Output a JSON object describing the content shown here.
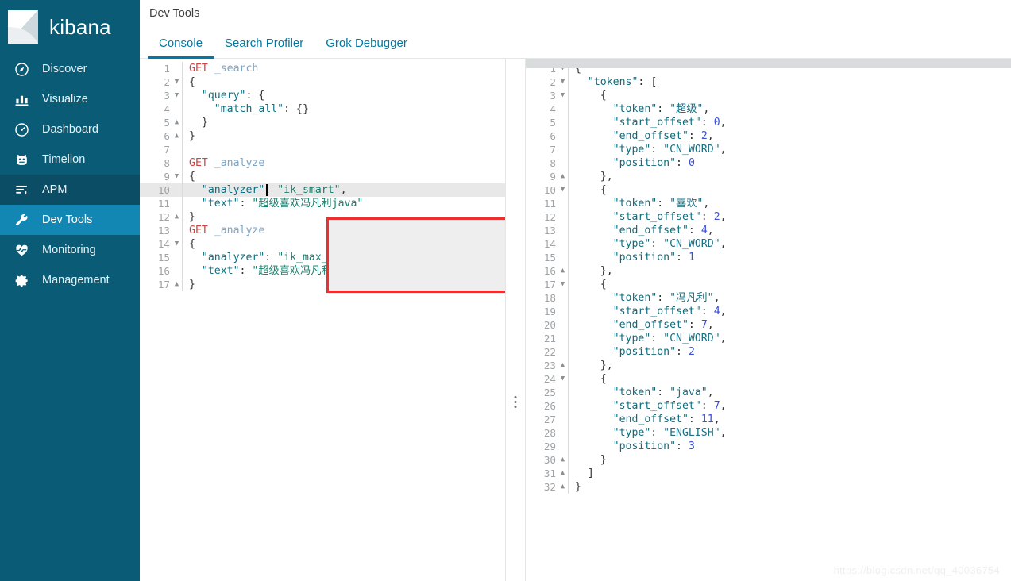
{
  "brand": {
    "name": "kibana",
    "logo_icon": "kibana-logo-icon"
  },
  "sidebar": {
    "items": [
      {
        "label": "Discover",
        "icon": "compass-icon",
        "state": "normal"
      },
      {
        "label": "Visualize",
        "icon": "bar-chart-icon",
        "state": "normal"
      },
      {
        "label": "Dashboard",
        "icon": "dashboard-icon",
        "state": "normal"
      },
      {
        "label": "Timelion",
        "icon": "timelion-icon",
        "state": "normal"
      },
      {
        "label": "APM",
        "icon": "apm-icon",
        "state": "hovered"
      },
      {
        "label": "Dev Tools",
        "icon": "wrench-icon",
        "state": "selected"
      },
      {
        "label": "Monitoring",
        "icon": "heartbeat-icon",
        "state": "normal"
      },
      {
        "label": "Management",
        "icon": "gear-icon",
        "state": "normal"
      }
    ]
  },
  "header": {
    "title": "Dev Tools",
    "tabs": [
      {
        "label": "Console",
        "active": true
      },
      {
        "label": "Search Profiler",
        "active": false
      },
      {
        "label": "Grok Debugger",
        "active": false
      }
    ]
  },
  "console": {
    "request_actions": {
      "play_icon": "play-icon",
      "wrench_icon": "wrench-icon"
    },
    "splitter_icon": "drag-handle-icon",
    "editor_lines": [
      {
        "n": 1,
        "fold": "",
        "active": false,
        "tokens": [
          {
            "t": "method",
            "v": "GET"
          },
          {
            "t": "plain",
            "v": " "
          },
          {
            "t": "url",
            "v": "_search"
          }
        ]
      },
      {
        "n": 2,
        "fold": "down",
        "active": false,
        "tokens": [
          {
            "t": "brace",
            "v": "{"
          }
        ]
      },
      {
        "n": 3,
        "fold": "down",
        "active": false,
        "tokens": [
          {
            "t": "plain",
            "v": "  "
          },
          {
            "t": "key",
            "v": "\"query\""
          },
          {
            "t": "punc",
            "v": ": "
          },
          {
            "t": "brace",
            "v": "{"
          }
        ]
      },
      {
        "n": 4,
        "fold": "",
        "active": false,
        "tokens": [
          {
            "t": "plain",
            "v": "    "
          },
          {
            "t": "key",
            "v": "\"match_all\""
          },
          {
            "t": "punc",
            "v": ": "
          },
          {
            "t": "brace",
            "v": "{}"
          }
        ]
      },
      {
        "n": 5,
        "fold": "up",
        "active": false,
        "tokens": [
          {
            "t": "plain",
            "v": "  "
          },
          {
            "t": "brace",
            "v": "}"
          }
        ]
      },
      {
        "n": 6,
        "fold": "up",
        "active": false,
        "tokens": [
          {
            "t": "brace",
            "v": "}"
          }
        ]
      },
      {
        "n": 7,
        "fold": "",
        "active": false,
        "tokens": []
      },
      {
        "n": 8,
        "fold": "",
        "active": false,
        "tokens": [
          {
            "t": "method",
            "v": "GET"
          },
          {
            "t": "plain",
            "v": " "
          },
          {
            "t": "url",
            "v": "_analyze"
          }
        ]
      },
      {
        "n": 9,
        "fold": "down",
        "active": false,
        "tokens": [
          {
            "t": "brace",
            "v": "{"
          }
        ]
      },
      {
        "n": 10,
        "fold": "",
        "active": true,
        "tokens": [
          {
            "t": "plain",
            "v": "  "
          },
          {
            "t": "key",
            "v": "\"analyzer\""
          },
          {
            "t": "punc",
            "v": ": "
          },
          {
            "t": "string",
            "v": "\"ik_smart\""
          },
          {
            "t": "punc",
            "v": ","
          }
        ]
      },
      {
        "n": 11,
        "fold": "",
        "active": false,
        "tokens": [
          {
            "t": "plain",
            "v": "  "
          },
          {
            "t": "key",
            "v": "\"text\""
          },
          {
            "t": "punc",
            "v": ": "
          },
          {
            "t": "string",
            "v": "\"超级喜欢冯凡利java\""
          }
        ]
      },
      {
        "n": 12,
        "fold": "up",
        "active": false,
        "tokens": [
          {
            "t": "brace",
            "v": "}"
          }
        ]
      },
      {
        "n": 13,
        "fold": "",
        "active": false,
        "tokens": [
          {
            "t": "method",
            "v": "GET"
          },
          {
            "t": "plain",
            "v": " "
          },
          {
            "t": "url",
            "v": "_analyze"
          }
        ]
      },
      {
        "n": 14,
        "fold": "down",
        "active": false,
        "tokens": [
          {
            "t": "brace",
            "v": "{"
          }
        ]
      },
      {
        "n": 15,
        "fold": "",
        "active": false,
        "tokens": [
          {
            "t": "plain",
            "v": "  "
          },
          {
            "t": "key",
            "v": "\"analyzer\""
          },
          {
            "t": "punc",
            "v": ": "
          },
          {
            "t": "string",
            "v": "\"ik_max_word\""
          },
          {
            "t": "punc",
            "v": ","
          }
        ]
      },
      {
        "n": 16,
        "fold": "",
        "active": false,
        "tokens": [
          {
            "t": "plain",
            "v": "  "
          },
          {
            "t": "key",
            "v": "\"text\""
          },
          {
            "t": "punc",
            "v": ": "
          },
          {
            "t": "string",
            "v": "\"超级喜欢冯凡利java\""
          }
        ]
      },
      {
        "n": 17,
        "fold": "up",
        "active": false,
        "tokens": [
          {
            "t": "brace",
            "v": "}"
          }
        ]
      }
    ],
    "response_lines": [
      {
        "n": 1,
        "fold": "down",
        "active": true,
        "tokens": [
          {
            "t": "brace",
            "v": "{"
          }
        ]
      },
      {
        "n": 2,
        "fold": "down",
        "active": false,
        "tokens": [
          {
            "t": "plain",
            "v": "  "
          },
          {
            "t": "reskey",
            "v": "\"tokens\""
          },
          {
            "t": "punc",
            "v": ": "
          },
          {
            "t": "brace",
            "v": "["
          }
        ]
      },
      {
        "n": 3,
        "fold": "down",
        "active": false,
        "tokens": [
          {
            "t": "plain",
            "v": "    "
          },
          {
            "t": "brace",
            "v": "{"
          }
        ]
      },
      {
        "n": 4,
        "fold": "",
        "active": false,
        "tokens": [
          {
            "t": "plain",
            "v": "      "
          },
          {
            "t": "reskey",
            "v": "\"token\""
          },
          {
            "t": "punc",
            "v": ": "
          },
          {
            "t": "resstr",
            "v": "\"超级\""
          },
          {
            "t": "punc",
            "v": ","
          }
        ]
      },
      {
        "n": 5,
        "fold": "",
        "active": false,
        "tokens": [
          {
            "t": "plain",
            "v": "      "
          },
          {
            "t": "reskey",
            "v": "\"start_offset\""
          },
          {
            "t": "punc",
            "v": ": "
          },
          {
            "t": "num",
            "v": "0"
          },
          {
            "t": "punc",
            "v": ","
          }
        ]
      },
      {
        "n": 6,
        "fold": "",
        "active": false,
        "tokens": [
          {
            "t": "plain",
            "v": "      "
          },
          {
            "t": "reskey",
            "v": "\"end_offset\""
          },
          {
            "t": "punc",
            "v": ": "
          },
          {
            "t": "num",
            "v": "2"
          },
          {
            "t": "punc",
            "v": ","
          }
        ]
      },
      {
        "n": 7,
        "fold": "",
        "active": false,
        "tokens": [
          {
            "t": "plain",
            "v": "      "
          },
          {
            "t": "reskey",
            "v": "\"type\""
          },
          {
            "t": "punc",
            "v": ": "
          },
          {
            "t": "resstr",
            "v": "\"CN_WORD\""
          },
          {
            "t": "punc",
            "v": ","
          }
        ]
      },
      {
        "n": 8,
        "fold": "",
        "active": false,
        "tokens": [
          {
            "t": "plain",
            "v": "      "
          },
          {
            "t": "reskey",
            "v": "\"position\""
          },
          {
            "t": "punc",
            "v": ": "
          },
          {
            "t": "num",
            "v": "0"
          }
        ]
      },
      {
        "n": 9,
        "fold": "up",
        "active": false,
        "tokens": [
          {
            "t": "plain",
            "v": "    "
          },
          {
            "t": "brace",
            "v": "},"
          }
        ]
      },
      {
        "n": 10,
        "fold": "down",
        "active": false,
        "tokens": [
          {
            "t": "plain",
            "v": "    "
          },
          {
            "t": "brace",
            "v": "{"
          }
        ]
      },
      {
        "n": 11,
        "fold": "",
        "active": false,
        "tokens": [
          {
            "t": "plain",
            "v": "      "
          },
          {
            "t": "reskey",
            "v": "\"token\""
          },
          {
            "t": "punc",
            "v": ": "
          },
          {
            "t": "resstr",
            "v": "\"喜欢\""
          },
          {
            "t": "punc",
            "v": ","
          }
        ]
      },
      {
        "n": 12,
        "fold": "",
        "active": false,
        "tokens": [
          {
            "t": "plain",
            "v": "      "
          },
          {
            "t": "reskey",
            "v": "\"start_offset\""
          },
          {
            "t": "punc",
            "v": ": "
          },
          {
            "t": "num",
            "v": "2"
          },
          {
            "t": "punc",
            "v": ","
          }
        ]
      },
      {
        "n": 13,
        "fold": "",
        "active": false,
        "tokens": [
          {
            "t": "plain",
            "v": "      "
          },
          {
            "t": "reskey",
            "v": "\"end_offset\""
          },
          {
            "t": "punc",
            "v": ": "
          },
          {
            "t": "num",
            "v": "4"
          },
          {
            "t": "punc",
            "v": ","
          }
        ]
      },
      {
        "n": 14,
        "fold": "",
        "active": false,
        "tokens": [
          {
            "t": "plain",
            "v": "      "
          },
          {
            "t": "reskey",
            "v": "\"type\""
          },
          {
            "t": "punc",
            "v": ": "
          },
          {
            "t": "resstr",
            "v": "\"CN_WORD\""
          },
          {
            "t": "punc",
            "v": ","
          }
        ]
      },
      {
        "n": 15,
        "fold": "",
        "active": false,
        "tokens": [
          {
            "t": "plain",
            "v": "      "
          },
          {
            "t": "reskey",
            "v": "\"position\""
          },
          {
            "t": "punc",
            "v": ": "
          },
          {
            "t": "num",
            "v": "1"
          }
        ]
      },
      {
        "n": 16,
        "fold": "up",
        "active": false,
        "tokens": [
          {
            "t": "plain",
            "v": "    "
          },
          {
            "t": "brace",
            "v": "},"
          }
        ]
      },
      {
        "n": 17,
        "fold": "down",
        "active": false,
        "tokens": [
          {
            "t": "plain",
            "v": "    "
          },
          {
            "t": "brace",
            "v": "{"
          }
        ]
      },
      {
        "n": 18,
        "fold": "",
        "active": false,
        "tokens": [
          {
            "t": "plain",
            "v": "      "
          },
          {
            "t": "reskey",
            "v": "\"token\""
          },
          {
            "t": "punc",
            "v": ": "
          },
          {
            "t": "resstr",
            "v": "\"冯凡利\""
          },
          {
            "t": "punc",
            "v": ","
          }
        ]
      },
      {
        "n": 19,
        "fold": "",
        "active": false,
        "tokens": [
          {
            "t": "plain",
            "v": "      "
          },
          {
            "t": "reskey",
            "v": "\"start_offset\""
          },
          {
            "t": "punc",
            "v": ": "
          },
          {
            "t": "num",
            "v": "4"
          },
          {
            "t": "punc",
            "v": ","
          }
        ]
      },
      {
        "n": 20,
        "fold": "",
        "active": false,
        "tokens": [
          {
            "t": "plain",
            "v": "      "
          },
          {
            "t": "reskey",
            "v": "\"end_offset\""
          },
          {
            "t": "punc",
            "v": ": "
          },
          {
            "t": "num",
            "v": "7"
          },
          {
            "t": "punc",
            "v": ","
          }
        ]
      },
      {
        "n": 21,
        "fold": "",
        "active": false,
        "tokens": [
          {
            "t": "plain",
            "v": "      "
          },
          {
            "t": "reskey",
            "v": "\"type\""
          },
          {
            "t": "punc",
            "v": ": "
          },
          {
            "t": "resstr",
            "v": "\"CN_WORD\""
          },
          {
            "t": "punc",
            "v": ","
          }
        ]
      },
      {
        "n": 22,
        "fold": "",
        "active": false,
        "tokens": [
          {
            "t": "plain",
            "v": "      "
          },
          {
            "t": "reskey",
            "v": "\"position\""
          },
          {
            "t": "punc",
            "v": ": "
          },
          {
            "t": "num",
            "v": "2"
          }
        ]
      },
      {
        "n": 23,
        "fold": "up",
        "active": false,
        "tokens": [
          {
            "t": "plain",
            "v": "    "
          },
          {
            "t": "brace",
            "v": "},"
          }
        ]
      },
      {
        "n": 24,
        "fold": "down",
        "active": false,
        "tokens": [
          {
            "t": "plain",
            "v": "    "
          },
          {
            "t": "brace",
            "v": "{"
          }
        ]
      },
      {
        "n": 25,
        "fold": "",
        "active": false,
        "tokens": [
          {
            "t": "plain",
            "v": "      "
          },
          {
            "t": "reskey",
            "v": "\"token\""
          },
          {
            "t": "punc",
            "v": ": "
          },
          {
            "t": "resstr",
            "v": "\"java\""
          },
          {
            "t": "punc",
            "v": ","
          }
        ]
      },
      {
        "n": 26,
        "fold": "",
        "active": false,
        "tokens": [
          {
            "t": "plain",
            "v": "      "
          },
          {
            "t": "reskey",
            "v": "\"start_offset\""
          },
          {
            "t": "punc",
            "v": ": "
          },
          {
            "t": "num",
            "v": "7"
          },
          {
            "t": "punc",
            "v": ","
          }
        ]
      },
      {
        "n": 27,
        "fold": "",
        "active": false,
        "tokens": [
          {
            "t": "plain",
            "v": "      "
          },
          {
            "t": "reskey",
            "v": "\"end_offset\""
          },
          {
            "t": "punc",
            "v": ": "
          },
          {
            "t": "num",
            "v": "11"
          },
          {
            "t": "punc",
            "v": ","
          }
        ]
      },
      {
        "n": 28,
        "fold": "",
        "active": false,
        "tokens": [
          {
            "t": "plain",
            "v": "      "
          },
          {
            "t": "reskey",
            "v": "\"type\""
          },
          {
            "t": "punc",
            "v": ": "
          },
          {
            "t": "resstr",
            "v": "\"ENGLISH\""
          },
          {
            "t": "punc",
            "v": ","
          }
        ]
      },
      {
        "n": 29,
        "fold": "",
        "active": false,
        "tokens": [
          {
            "t": "plain",
            "v": "      "
          },
          {
            "t": "reskey",
            "v": "\"position\""
          },
          {
            "t": "punc",
            "v": ": "
          },
          {
            "t": "num",
            "v": "3"
          }
        ]
      },
      {
        "n": 30,
        "fold": "up",
        "active": false,
        "tokens": [
          {
            "t": "plain",
            "v": "    "
          },
          {
            "t": "brace",
            "v": "}"
          }
        ]
      },
      {
        "n": 31,
        "fold": "up",
        "active": false,
        "tokens": [
          {
            "t": "plain",
            "v": "  "
          },
          {
            "t": "brace",
            "v": "]"
          }
        ]
      },
      {
        "n": 32,
        "fold": "up",
        "active": false,
        "tokens": [
          {
            "t": "brace",
            "v": "}"
          }
        ]
      }
    ]
  },
  "watermark": {
    "text": "https://blog.csdn.net/qq_40036754"
  },
  "colors": {
    "sidebar_bg": "#0a5b75",
    "sidebar_selected": "#1387b3",
    "sidebar_hovered": "#0a4d64",
    "tab_accent": "#0079a5",
    "annotation_red": "#ee2f2f",
    "play_green": "#55b848"
  }
}
